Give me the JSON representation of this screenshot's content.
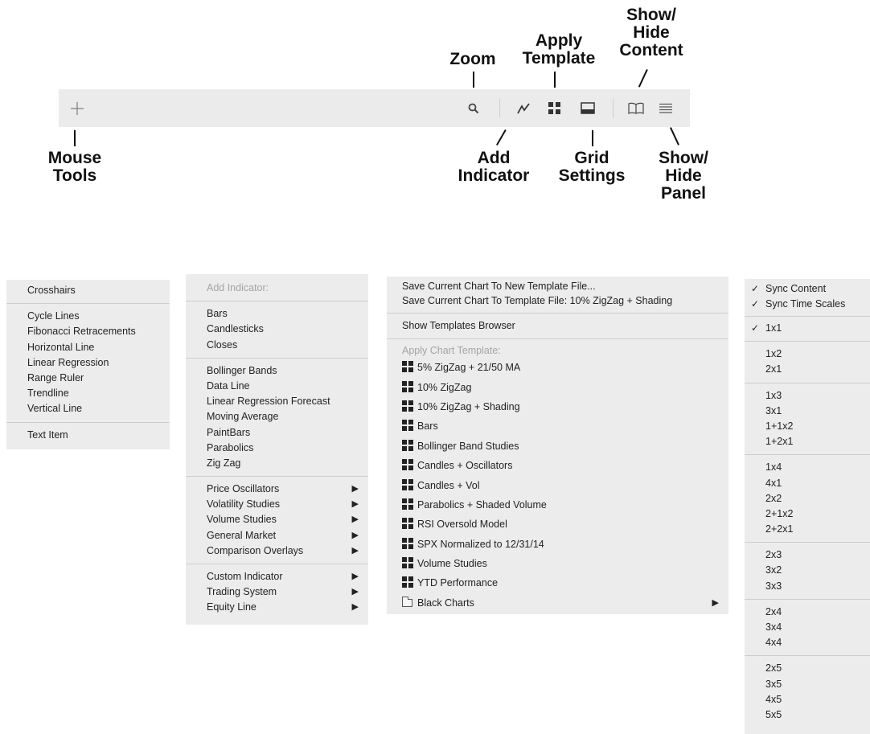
{
  "callouts": {
    "zoom": "Zoom",
    "apply_template": "Apply\nTemplate",
    "show_hide_content": "Show/\nHide\nContent",
    "mouse_tools": "Mouse\nTools",
    "add_indicator": "Add\nIndicator",
    "grid_settings": "Grid\nSettings",
    "show_hide_panel": "Show/\nHide\nPanel"
  },
  "toolbar_icons": [
    "crosshair-icon",
    "search-icon",
    "indicator-icon",
    "grid-icon",
    "panel-icon",
    "book-icon",
    "list-icon"
  ],
  "mouse_tools_menu": {
    "groups": [
      [
        "Crosshairs"
      ],
      [
        "Cycle Lines",
        "Fibonacci Retracements",
        "Horizontal Line",
        "Linear Regression",
        "Range Ruler",
        "Trendline",
        "Vertical Line"
      ],
      [
        "Text Item"
      ]
    ]
  },
  "indicator_menu": {
    "header": "Add Indicator:",
    "groups": [
      [
        {
          "label": "Bars"
        },
        {
          "label": "Candlesticks"
        },
        {
          "label": "Closes"
        }
      ],
      [
        {
          "label": "Bollinger Bands"
        },
        {
          "label": "Data Line"
        },
        {
          "label": "Linear Regression Forecast"
        },
        {
          "label": "Moving Average"
        },
        {
          "label": "PaintBars"
        },
        {
          "label": "Parabolics"
        },
        {
          "label": "Zig Zag"
        }
      ],
      [
        {
          "label": "Price Oscillators",
          "submenu": true
        },
        {
          "label": "Volatility Studies",
          "submenu": true
        },
        {
          "label": "Volume Studies",
          "submenu": true
        },
        {
          "label": "General Market",
          "submenu": true
        },
        {
          "label": "Comparison Overlays",
          "submenu": true
        }
      ],
      [
        {
          "label": "Custom Indicator",
          "submenu": true
        },
        {
          "label": "Trading System",
          "submenu": true
        },
        {
          "label": "Equity Line",
          "submenu": true
        }
      ]
    ]
  },
  "template_menu": {
    "save_new": "Save Current Chart To New Template File...",
    "save_current": "Save Current Chart To Template File:  10% ZigZag + Shading",
    "show_browser": "Show Templates Browser",
    "apply_header": "Apply Chart Template:",
    "templates": [
      "5% ZigZag + 21/50 MA",
      "10% ZigZag",
      "10% ZigZag + Shading",
      "Bars",
      "Bollinger Band Studies",
      "Candles + Oscillators",
      "Candles + Vol",
      "Parabolics + Shaded Volume",
      "RSI Oversold Model",
      "SPX Normalized to 12/31/14",
      "Volume Studies",
      "YTD Performance"
    ],
    "folder": "Black Charts"
  },
  "grid_menu": {
    "sync_content": "Sync Content",
    "sync_time_scales": "Sync Time Scales",
    "check_mark": "✓",
    "groups": [
      [
        "1x1"
      ],
      [
        "1x2",
        "2x1"
      ],
      [
        "1x3",
        "3x1",
        "1+1x2",
        "1+2x1"
      ],
      [
        "1x4",
        "4x1",
        "2x2",
        "2+1x2",
        "2+2x1"
      ],
      [
        "2x3",
        "3x2",
        "3x3"
      ],
      [
        "2x4",
        "3x4",
        "4x4"
      ],
      [
        "2x5",
        "3x5",
        "4x5",
        "5x5"
      ]
    ],
    "selected": "1x1"
  }
}
